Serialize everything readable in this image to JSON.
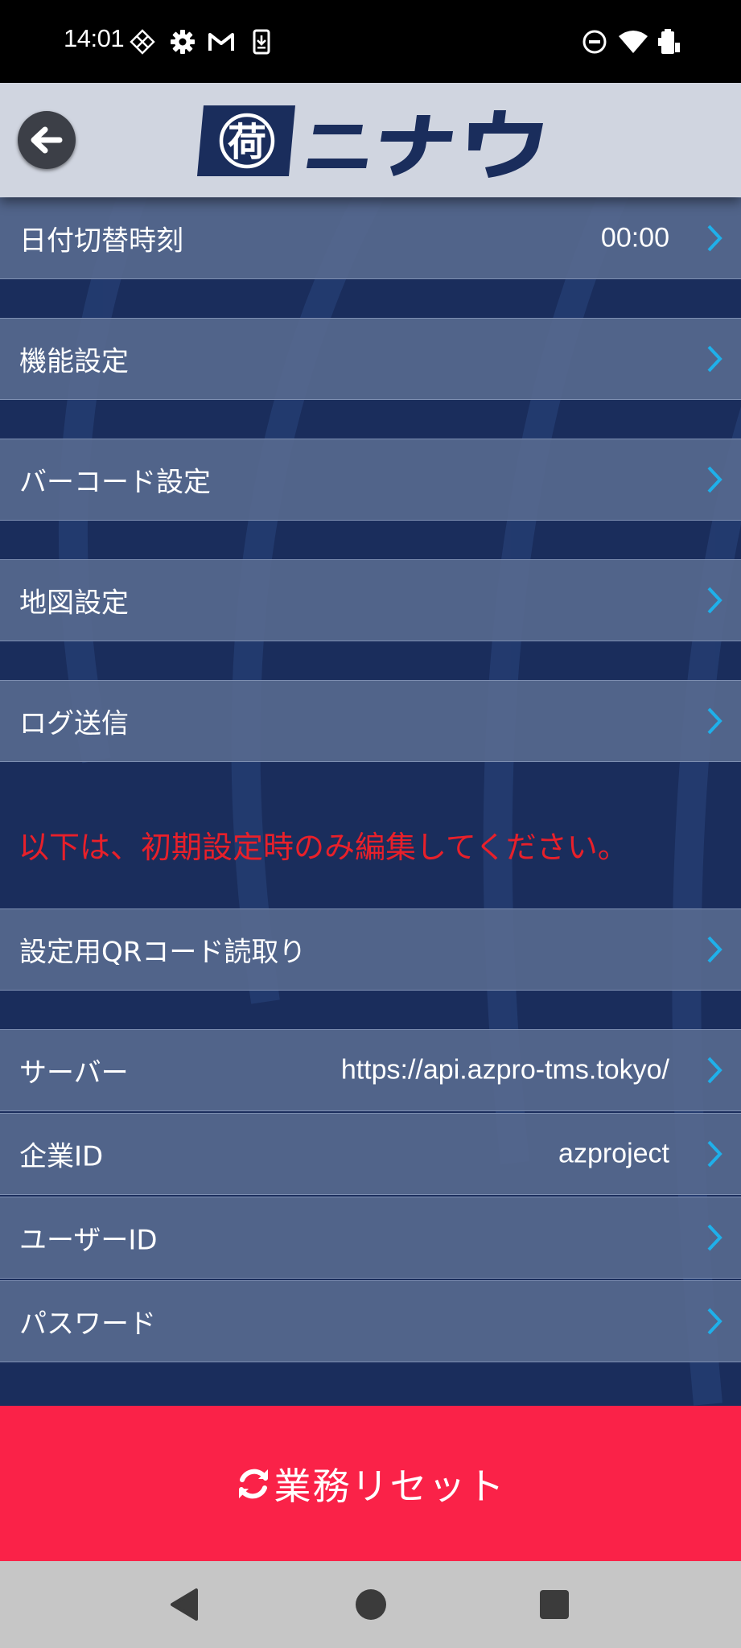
{
  "status_bar": {
    "time": "14:01",
    "icons_left": [
      "diamond-grid-icon",
      "gear-icon",
      "gmail-icon",
      "download-phone-icon"
    ],
    "icons_right": [
      "do-not-disturb-icon",
      "wifi-icon",
      "battery-icon"
    ]
  },
  "header": {
    "logo_text": "ニナウ",
    "logo_kanji": "荷",
    "colors": {
      "background": "#d0d5e0",
      "logo": "#1a2d5c"
    }
  },
  "settings": {
    "date_switch": {
      "label": "日付切替時刻",
      "value": "00:00"
    },
    "function": {
      "label": "機能設定"
    },
    "barcode": {
      "label": "バーコード設定"
    },
    "map": {
      "label": "地図設定"
    },
    "log_send": {
      "label": "ログ送信"
    },
    "warning": "以下は、初期設定時のみ編集してください。",
    "qr_read": {
      "label": "設定用QRコード読取り"
    },
    "server": {
      "label": "サーバー",
      "value": "https://api.azpro-tms.tokyo/"
    },
    "company_id": {
      "label": "企業ID",
      "value": "azproject"
    },
    "user_id": {
      "label": "ユーザーID",
      "value": ""
    },
    "password": {
      "label": "パスワード",
      "value": ""
    }
  },
  "reset_button": {
    "label": "業務リセット",
    "icon": "refresh-icon"
  },
  "colors": {
    "background": "#1a2d5c",
    "row": "#56688e",
    "chevron": "#1fb0ea",
    "warning": "#e8202a",
    "reset": "#fa2248"
  },
  "nav_bar": {
    "buttons": [
      "back-triangle-icon",
      "home-circle-icon",
      "recents-square-icon"
    ]
  }
}
